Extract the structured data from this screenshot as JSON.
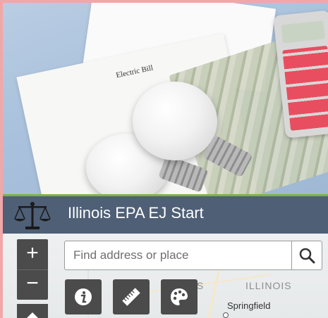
{
  "header": {
    "title": "Illinois EPA EJ Start",
    "logo_icon": "scales-of-justice-icon",
    "accent_color": "#7cb342",
    "background_color": "#4e5f76"
  },
  "hero": {
    "paper_text": "Electric Bill"
  },
  "search": {
    "placeholder": "Find address or place",
    "button_icon": "search-icon"
  },
  "zoom": {
    "in_label": "+",
    "out_label": "−"
  },
  "tools": [
    {
      "icon": "info-icon"
    },
    {
      "icon": "measure-ruler-icon"
    },
    {
      "icon": "basemap-palette-icon"
    }
  ],
  "map": {
    "labels": [
      "IS",
      "ILLINOIS"
    ],
    "city": "Springfield"
  }
}
